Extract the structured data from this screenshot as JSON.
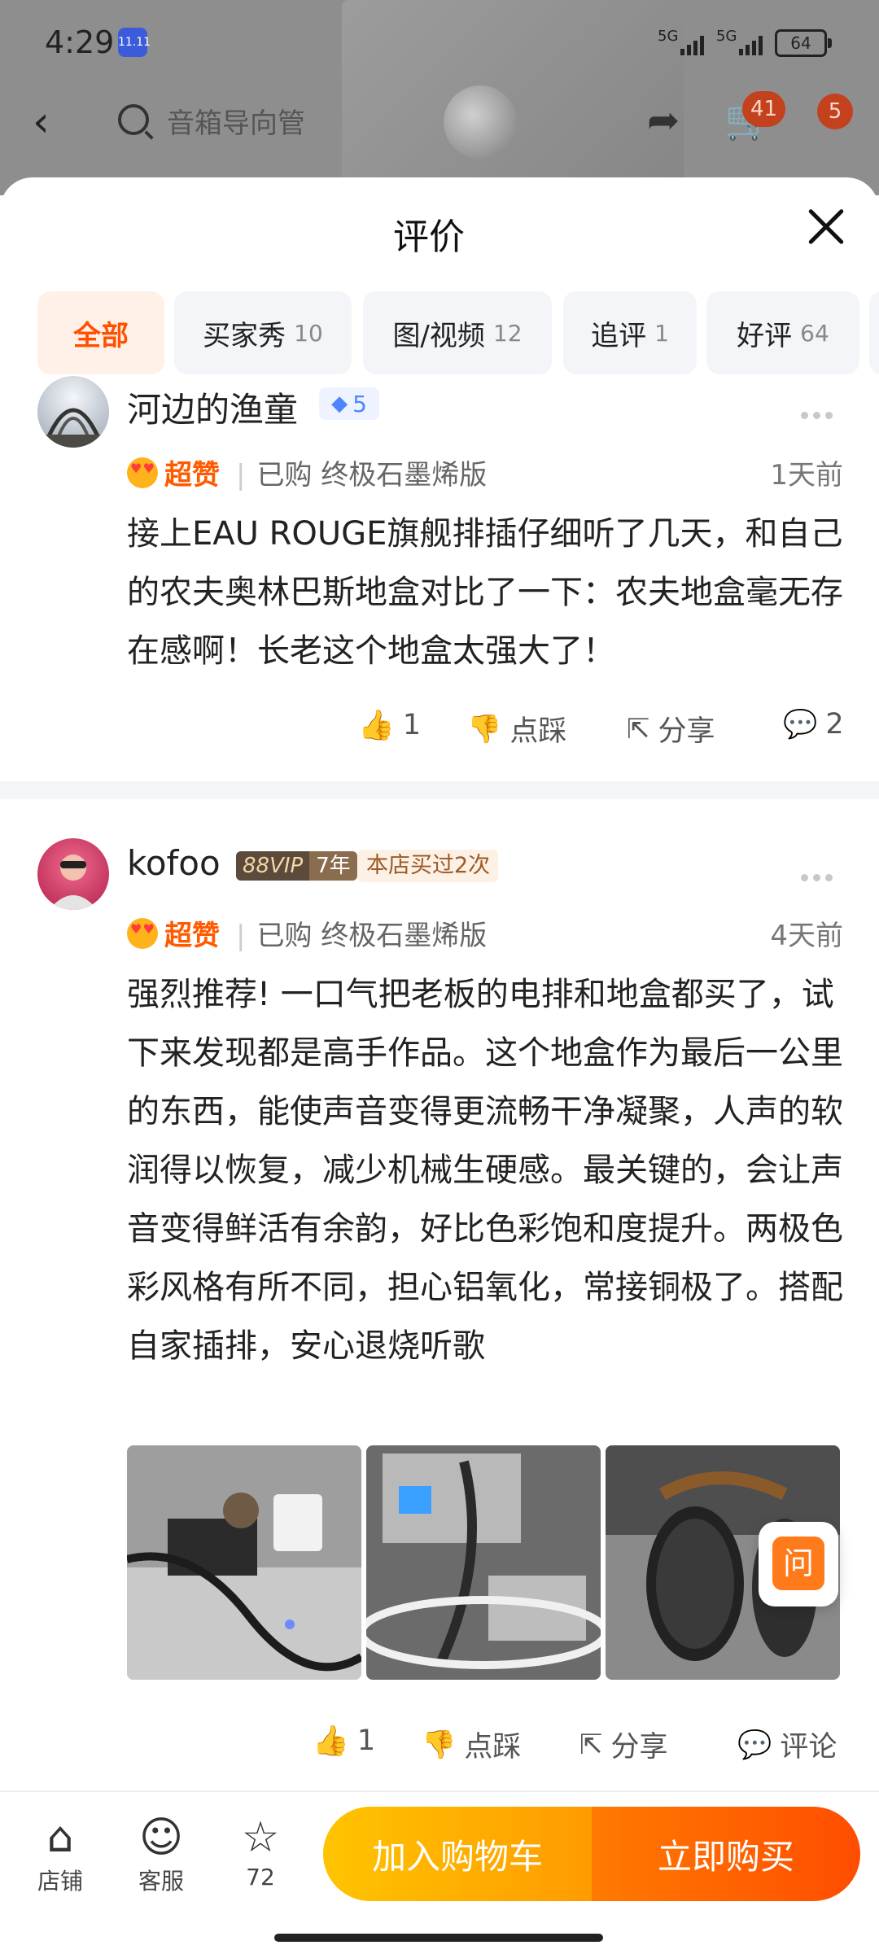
{
  "status_bar": {
    "time": "4:29",
    "app_icon_text": "11.11",
    "signal_1": "5G",
    "signal_2": "5G",
    "battery": "64"
  },
  "nav": {
    "search_placeholder": "音箱导向管",
    "cart_badge": "41",
    "more_badge": "5"
  },
  "sheet": {
    "title": "评价"
  },
  "tabs": [
    {
      "label": "全部",
      "count": ""
    },
    {
      "label": "买家秀",
      "count": "10"
    },
    {
      "label": "图/视频",
      "count": "12"
    },
    {
      "label": "追评",
      "count": "1"
    },
    {
      "label": "好评",
      "count": "64"
    }
  ],
  "reviews": [
    {
      "username": "河边的渔童",
      "level": "5",
      "rating": "超赞",
      "bought": "已购 终极石墨烯版",
      "time": "1天前",
      "content": "接上EAU ROUGE旗舰排插仔细听了几天，和自己的农夫奥林巴斯地盒对比了一下：农夫地盒毫无存在感啊！长老这个地盒太强大了！",
      "likes": "1",
      "dislike_label": "点踩",
      "share_label": "分享",
      "comments": "2"
    },
    {
      "username": "kofoo",
      "vip_label": "88VIP",
      "vip_years": "7年",
      "store_badge": "本店买过2次",
      "rating": "超赞",
      "bought": "已购 终极石墨烯版",
      "time": "4天前",
      "content": "强烈推荐! 一口气把老板的电排和地盒都买了，试下来发现都是高手作品。这个地盒作为最后一公里的东西，能使声音变得更流畅干净凝聚，人声的软润得以恢复，减少机械生硬感。最关键的，会让声音变得鲜活有余韵，好比色彩饱和度提升。两极色彩风格有所不同，担心铝氧化，常接铜极了。搭配自家插排，安心退烧听歌",
      "likes": "1",
      "dislike_label": "点踩",
      "share_label": "分享",
      "comment_label": "评论",
      "ask_label": "问"
    }
  ],
  "bottom_bar": {
    "store_label": "店铺",
    "service_label": "客服",
    "favorite_count": "72",
    "add_cart_label": "加入购物车",
    "buy_now_label": "立即购买"
  },
  "colors": {
    "accent": "#ff5000",
    "cart_gradient": [
      "#ffc400",
      "#ff9b00"
    ],
    "buy_gradient": [
      "#ff7a00",
      "#ff4d00"
    ]
  }
}
